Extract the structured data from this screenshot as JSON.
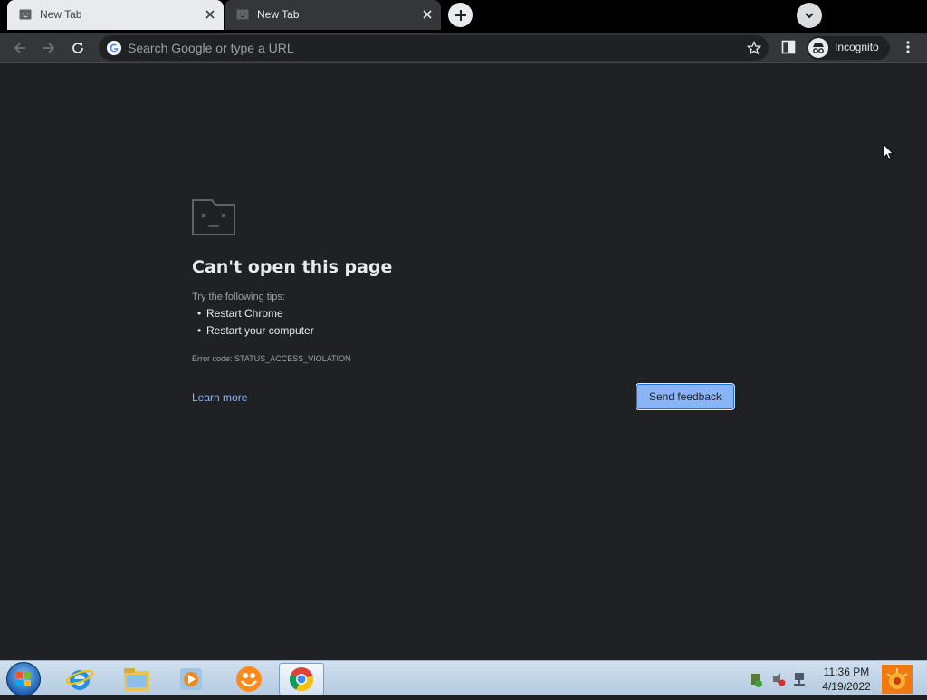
{
  "browser": {
    "tabs": [
      {
        "title": "New Tab",
        "active": false
      },
      {
        "title": "New Tab",
        "active": true
      }
    ],
    "omnibox": {
      "placeholder": "Search Google or type a URL",
      "value": ""
    },
    "profile": {
      "label": "Incognito"
    }
  },
  "error_page": {
    "title": "Can't open this page",
    "tips_heading": "Try the following tips:",
    "tips": [
      "Restart Chrome",
      "Restart your computer"
    ],
    "error_code": "Error code: STATUS_ACCESS_VIOLATION",
    "learn_more": "Learn more",
    "send_feedback": "Send feedback"
  },
  "taskbar": {
    "time": "11:36 PM",
    "date": "4/19/2022",
    "apps": [
      "internet-explorer-icon",
      "file-explorer-icon",
      "media-player-icon",
      "uc-browser-icon",
      "chrome-icon"
    ]
  },
  "colors": {
    "page_bg": "#202124",
    "toolbar_bg": "#35363a",
    "link": "#8ab4f8",
    "button": "#8ab4f8"
  }
}
